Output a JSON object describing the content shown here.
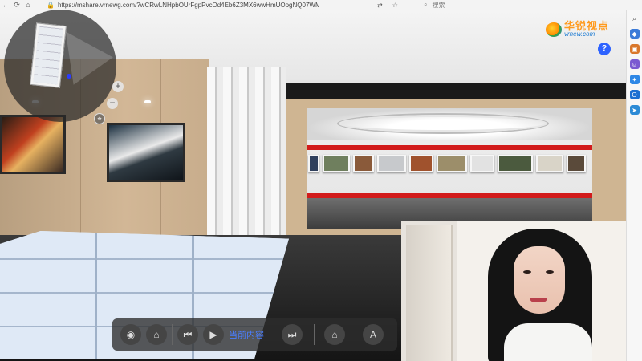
{
  "browser": {
    "url": "https://mshare.vrnewg.com/?wCRwLNHpbOUrFgpPvcOd4Eb6Z3MX6wwHmUOogNQ07WM=",
    "search_placeholder": "搜索"
  },
  "logo": {
    "title": "华锐视点",
    "subtitle": "vrnew.com"
  },
  "help_button": "?",
  "minimap": {
    "zoom_in": "+",
    "zoom_out": "−",
    "locate": "⌖"
  },
  "toolbar": {
    "current_content_label": "当前内容",
    "text_size_label": "A"
  },
  "colors": {
    "accent_blue": "#4a7dff",
    "gallery_stripe_red": "#d21b1b",
    "logo_orange": "#ff9a1e"
  }
}
